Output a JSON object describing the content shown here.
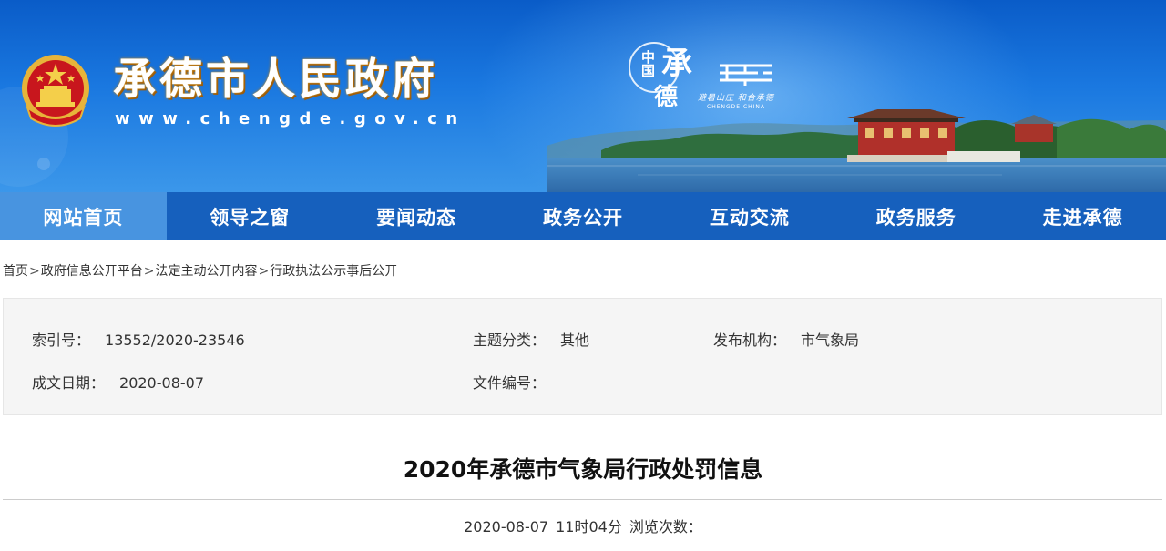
{
  "header": {
    "site_title": "承德市人民政府",
    "site_url": "www.chengde.gov.cn",
    "city_logo": {
      "zhongguo": "中国",
      "cheng": "承",
      "de": "德",
      "slogan": "避暑山庄 和合承德",
      "english": "CHENGDE CHINA"
    },
    "emblem_icon": "national-emblem-icon"
  },
  "nav": {
    "items": [
      {
        "label": "网站首页",
        "active": true
      },
      {
        "label": "领导之窗",
        "active": false
      },
      {
        "label": "要闻动态",
        "active": false
      },
      {
        "label": "政务公开",
        "active": false
      },
      {
        "label": "互动交流",
        "active": false
      },
      {
        "label": "政务服务",
        "active": false
      },
      {
        "label": "走进承德",
        "active": false
      }
    ]
  },
  "breadcrumb": {
    "items": [
      "首页",
      "政府信息公开平台",
      "法定主动公开内容",
      "行政执法公示事后公开"
    ],
    "separator": ">"
  },
  "info": {
    "index_label": "索引号：",
    "index_value": "13552/2020-23546",
    "topic_label": "主题分类：",
    "topic_value": "其他",
    "publisher_label": "发布机构：",
    "publisher_value": "市气象局",
    "date_label": "成文日期：",
    "date_value": "2020-08-07",
    "docno_label": "文件编号：",
    "docno_value": ""
  },
  "article": {
    "title": "2020年承德市气象局行政处罚信息",
    "publish_date": "2020-08-07",
    "publish_time": "11时04分",
    "views_label": "浏览次数："
  },
  "colors": {
    "nav_bg": "#1660bd",
    "nav_active": "#4894e0",
    "banner_top": "#0a5cc8",
    "info_bg": "#f5f5f5"
  }
}
